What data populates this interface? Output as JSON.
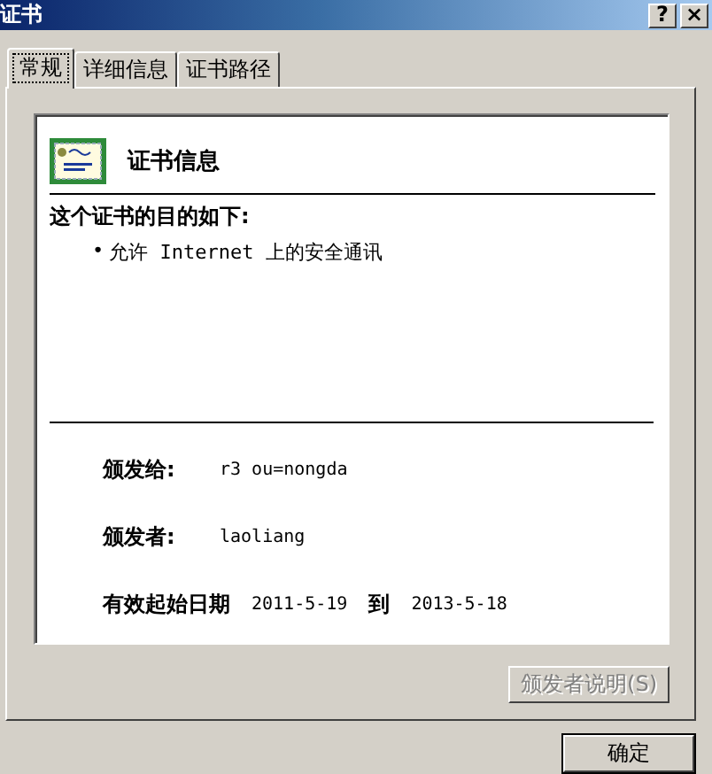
{
  "window": {
    "title": "证书",
    "help_button": "?",
    "close_button": "×"
  },
  "tabs": [
    {
      "label": "常规",
      "selected": true
    },
    {
      "label": "详细信息",
      "selected": false
    },
    {
      "label": "证书路径",
      "selected": false
    }
  ],
  "info": {
    "title": "证书信息",
    "purpose_heading": "这个证书的目的如下:",
    "purposes": [
      {
        "bullet": "•",
        "text": "允许 Internet 上的安全通讯"
      }
    ]
  },
  "fields": [
    {
      "kind": "pair",
      "label": "颁发给:",
      "value": "r3 ou=nongda"
    },
    {
      "kind": "pair",
      "label": "颁发者:",
      "value": "laoliang"
    },
    {
      "kind": "range",
      "label": "有效起始日期",
      "from": "2011-5-19",
      "to_label": "到",
      "to": "2013-5-18"
    }
  ],
  "issuer_statement_button": {
    "label": "颁发者说明(S)",
    "disabled": true
  },
  "ok_button": {
    "label": "确定"
  }
}
